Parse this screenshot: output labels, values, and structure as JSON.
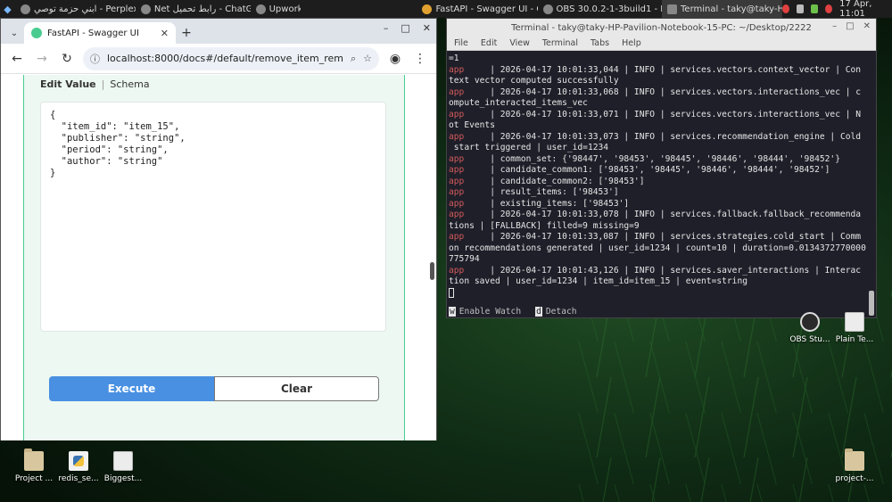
{
  "panel": {
    "tasks": [
      {
        "label": "ابني حزمة توصي - Perplexity",
        "active": false
      },
      {
        "label": "Net رابط تحميل - ChatGPT",
        "active": false
      },
      {
        "label": "Upwork",
        "active": false
      },
      {
        "label": "FastAPI - Swagger UI - G...",
        "active": true
      },
      {
        "label": "OBS 30.0.2-1-3build1 - Pr...",
        "active": false
      },
      {
        "label": "Terminal - taky@taky-HP...",
        "active": false
      }
    ],
    "clock": "17 Apr, 11:01"
  },
  "browser": {
    "tab_title": "FastAPI - Swagger UI",
    "url": "localhost:8000/docs#/default/remove_item_remov...",
    "edit_tab": "Edit Value",
    "schema_tab": "Schema",
    "request_body": "{\n  \"item_id\": \"item_15\",\n  \"publisher\": \"string\",\n  \"period\": \"string\",\n  \"author\": \"string\"\n}",
    "execute_label": "Execute",
    "clear_label": "Clear"
  },
  "terminal": {
    "title": "Terminal - taky@taky-HP-Pavilion-Notebook-15-PC: ~/Desktop/2222",
    "menu": [
      "File",
      "Edit",
      "View",
      "Terminal",
      "Tabs",
      "Help"
    ],
    "lines": [
      {
        "prefix": "",
        "text": "=1"
      },
      {
        "prefix": "app",
        "text": "     | 2026-04-17 10:01:33,044 | INFO | services.vectors.context_vector | Con"
      },
      {
        "prefix": "",
        "text": "text vector computed successfully"
      },
      {
        "prefix": "app",
        "text": "     | 2026-04-17 10:01:33,068 | INFO | services.vectors.interactions_vec | c"
      },
      {
        "prefix": "",
        "text": "ompute_interacted_items_vec"
      },
      {
        "prefix": "app",
        "text": "     | 2026-04-17 10:01:33,071 | INFO | services.vectors.interactions_vec | N"
      },
      {
        "prefix": "",
        "text": "ot Events"
      },
      {
        "prefix": "app",
        "text": "     | 2026-04-17 10:01:33,073 | INFO | services.recommendation_engine | Cold"
      },
      {
        "prefix": "",
        "text": " start triggered | user_id=1234"
      },
      {
        "prefix": "app",
        "text": "     | common_set: {'98447', '98453', '98445', '98446', '98444', '98452'}"
      },
      {
        "prefix": "app",
        "text": "     | candidate_common1: ['98453', '98445', '98446', '98444', '98452']"
      },
      {
        "prefix": "app",
        "text": "     | candidate_common2: ['98453']"
      },
      {
        "prefix": "app",
        "text": "     | result_items: ['98453']"
      },
      {
        "prefix": "app",
        "text": "     | existing_items: ['98453']"
      },
      {
        "prefix": "app",
        "text": "     | 2026-04-17 10:01:33,078 | INFO | services.fallback.fallback_recommenda"
      },
      {
        "prefix": "",
        "text": "tions | [FALLBACK] filled=9 missing=9"
      },
      {
        "prefix": "app",
        "text": "     | 2026-04-17 10:01:33,087 | INFO | services.strategies.cold_start | Comm"
      },
      {
        "prefix": "",
        "text": "on recommendations generated | user_id=1234 | count=10 | duration=0.0134372770000"
      },
      {
        "prefix": "",
        "text": "775794"
      },
      {
        "prefix": "app",
        "text": "     | 2026-04-17 10:01:43,126 | INFO | services.saver_interactions | Interac"
      },
      {
        "prefix": "",
        "text": "tion saved | user_id=1234 | item_id=item_15 | event=string"
      }
    ],
    "footer": {
      "watch_key": "w",
      "watch_label": "Enable Watch",
      "detach_key": "d",
      "detach_label": "Detach"
    }
  },
  "desktop_icons": [
    {
      "label": "Project ...",
      "kind": "folder-icon"
    },
    {
      "label": "redis_se...",
      "kind": "python-file-icon"
    },
    {
      "label": "Biggest...",
      "kind": "text-file-icon"
    },
    {
      "label": "project-...",
      "kind": "folder-icon"
    },
    {
      "label": "OBS Stu...",
      "kind": "obs-icon"
    },
    {
      "label": "Plain Te...",
      "kind": "text-file-icon"
    }
  ]
}
